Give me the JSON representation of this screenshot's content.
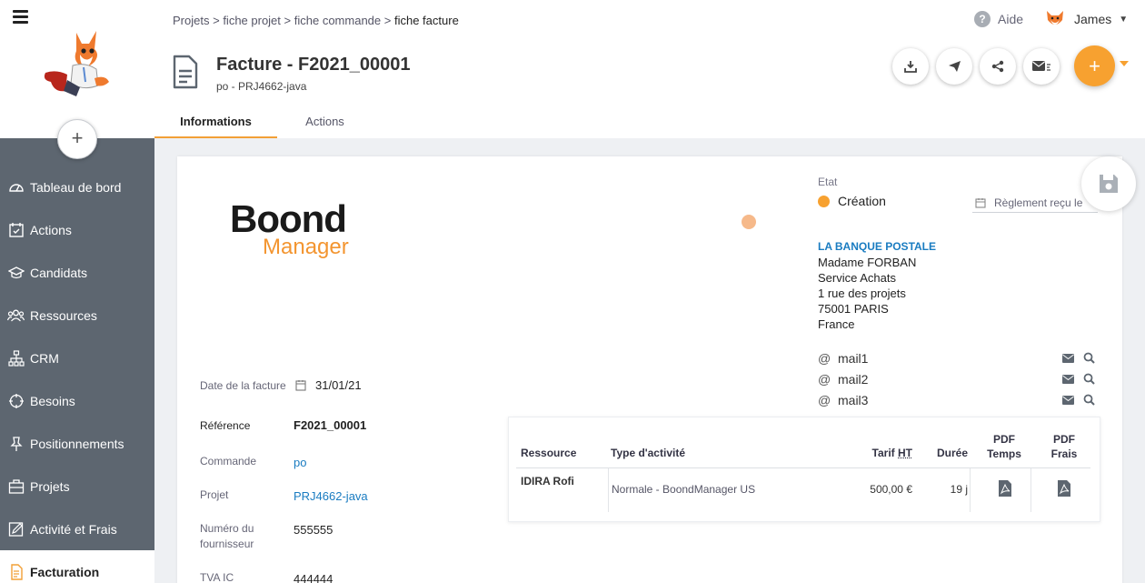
{
  "breadcrumb": {
    "items": [
      "Projets",
      "fiche projet",
      "fiche commande"
    ],
    "current": "fiche facture",
    "sep": ">"
  },
  "header": {
    "help_label": "Aide",
    "user_name": "James",
    "title": "Facture - F2021_00001",
    "subtitle": "po - PRJ4662-java"
  },
  "tabs": [
    "Informations",
    "Actions"
  ],
  "sidebar": {
    "add_symbol": "+",
    "items": [
      {
        "label": "Tableau de bord",
        "icon": "dashboard-icon"
      },
      {
        "label": "Actions",
        "icon": "calendar-check-icon"
      },
      {
        "label": "Candidats",
        "icon": "graduation-cap-icon"
      },
      {
        "label": "Ressources",
        "icon": "users-icon"
      },
      {
        "label": "CRM",
        "icon": "org-chart-icon"
      },
      {
        "label": "Besoins",
        "icon": "crosshair-icon"
      },
      {
        "label": "Positionnements",
        "icon": "pin-icon"
      },
      {
        "label": "Projets",
        "icon": "briefcase-icon"
      },
      {
        "label": "Activité et Frais",
        "icon": "edit-icon"
      },
      {
        "label": "Facturation",
        "icon": "invoice-icon"
      }
    ]
  },
  "invoice": {
    "logo": {
      "line1": "Boond",
      "line2": "Manager"
    },
    "etat_label": "Etat",
    "etat_value": "Création",
    "reglement_placeholder": "Règlement reçu le",
    "client": {
      "name": "LA BANQUE POSTALE",
      "lines": [
        "Madame FORBAN",
        "Service Achats",
        "1 rue des projets",
        "75001 PARIS",
        "France"
      ]
    },
    "mails": [
      "mail1",
      "mail2",
      "mail3"
    ],
    "fields": [
      {
        "label": "Date de la facture",
        "value": "31/01/21"
      },
      {
        "label": "Référence",
        "value": "F2021_00001"
      },
      {
        "label": "Commande",
        "value": "po"
      },
      {
        "label": "Projet",
        "value": "PRJ4662-java"
      },
      {
        "label": "Numéro du fournisseur",
        "value": "555555"
      },
      {
        "label": "TVA IC",
        "value": "444444"
      }
    ]
  },
  "table": {
    "headers": {
      "ressource": "Ressource",
      "type": "Type d'activité",
      "tarif_pre": "Tarif ",
      "tarif_ht": "HT",
      "duree": "Durée",
      "pdf_temps": [
        "PDF",
        "Temps"
      ],
      "pdf_frais": [
        "PDF",
        "Frais"
      ]
    },
    "rows": [
      {
        "ressource": "IDIRA Rofi",
        "type": "Normale - BoondManager US",
        "tarif": "500,00 €",
        "duree": "19 j"
      }
    ]
  },
  "colors": {
    "accent": "#f7a130",
    "sidebar": "#5d6670",
    "link": "#1a7cc1"
  }
}
